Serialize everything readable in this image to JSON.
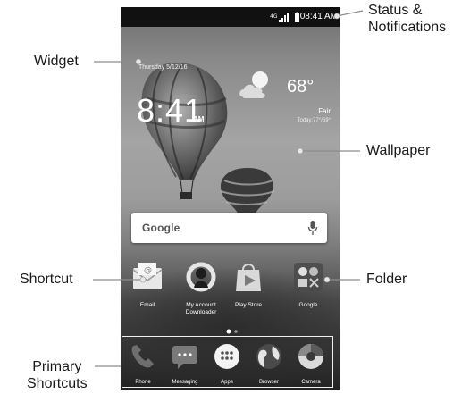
{
  "callouts": {
    "status": [
      "Status &",
      "Notifications"
    ],
    "widget": "Widget",
    "wallpaper": "Wallpaper",
    "shortcut": "Shortcut",
    "folder": "Folder",
    "primary": [
      "Primary",
      "Shortcuts"
    ]
  },
  "statusbar": {
    "time": "08:41 AM",
    "icons": [
      "signal-icon",
      "battery-icon"
    ]
  },
  "widget": {
    "date": "Thursday 5/12/16",
    "time": "8:41",
    "ampm": "AM",
    "temperature": "68°",
    "condition": "Fair",
    "today_range": "Today:77°/59°",
    "weather_icon": "partly-sunny-icon"
  },
  "search": {
    "logo": "Google",
    "mic_icon": "mic-icon"
  },
  "home_apps": [
    {
      "label": "Email",
      "icon": "email-icon"
    },
    {
      "label": "My Account Downloader",
      "icon": "my-account-icon"
    },
    {
      "label": "Play Store",
      "icon": "play-store-icon"
    },
    {
      "label": "Google",
      "icon": "google-folder-icon"
    }
  ],
  "dock_apps": [
    {
      "label": "Phone",
      "icon": "phone-icon"
    },
    {
      "label": "Messaging",
      "icon": "messaging-icon"
    },
    {
      "label": "Apps",
      "icon": "apps-icon"
    },
    {
      "label": "Browser",
      "icon": "browser-icon"
    },
    {
      "label": "Camera",
      "icon": "camera-icon"
    }
  ],
  "colors": {
    "callout_line": "#8c8c8c",
    "callout_dot": "#e8e8e8",
    "statusbar": "#111111"
  }
}
